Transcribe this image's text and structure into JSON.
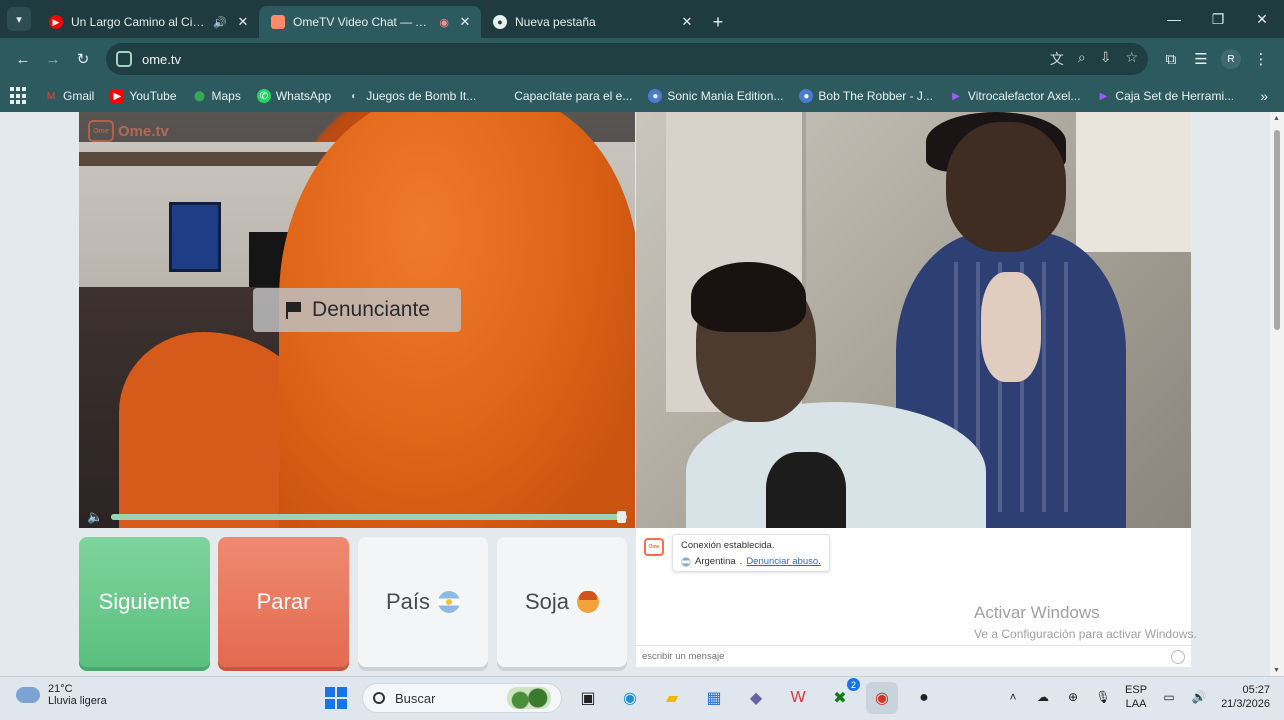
{
  "tabs": [
    {
      "title": "Un Largo Camino al Cielo |",
      "favicon": "youtube-icon",
      "favicon_color": "#ff0000",
      "extra": "audio-icon"
    },
    {
      "title": "OmeTV Video Chat — Alter",
      "favicon": "ometv-icon",
      "favicon_color": "#ff6b4a",
      "extra": "recording-icon"
    },
    {
      "title": "Nueva pestaña",
      "favicon": "chrome-icon",
      "favicon_color": "#e6eeee",
      "extra": ""
    }
  ],
  "toolbar": {
    "url": "ome.tv",
    "profile_initial": "R"
  },
  "bookmarks": [
    {
      "label": "Gmail",
      "icon": "gmail-icon",
      "color": "#ea4335"
    },
    {
      "label": "YouTube",
      "icon": "youtube-icon",
      "color": "#ff0000"
    },
    {
      "label": "Maps",
      "icon": "maps-icon",
      "color": "#34a853"
    },
    {
      "label": "WhatsApp",
      "icon": "whatsapp-icon",
      "color": "#25d366"
    },
    {
      "label": "Juegos de Bomb It...",
      "icon": "bomb-icon",
      "color": "#cccccc"
    },
    {
      "label": "Capacítate para el e...",
      "icon": "none",
      "color": ""
    },
    {
      "label": "Sonic Mania Edition...",
      "icon": "gamepad-icon",
      "color": "#4a7bd1"
    },
    {
      "label": "Bob The Robber - J...",
      "icon": "gamepad-icon",
      "color": "#4a7bd1"
    },
    {
      "label": "Vitrocalefactor Axel...",
      "icon": "arrow-icon",
      "color": "#7b3fe4"
    },
    {
      "label": "Caja Set de Herrami...",
      "icon": "arrow-icon",
      "color": "#7b3fe4"
    }
  ],
  "video": {
    "logo_text": "Ome.tv",
    "report_label": "Denunciante",
    "volume_level": 0.99
  },
  "controls": {
    "next_label": "Siguiente",
    "stop_label": "Parar",
    "country_label": "País",
    "gender_label": "Soja"
  },
  "chat": {
    "status": "Conexión establecida.",
    "country": "Argentina",
    "report_abuse": "Denunciar abuso.",
    "input_placeholder": "escribir un mensaje"
  },
  "watermark": {
    "line1": "Activar Windows",
    "line2": "Ve a Configuración para activar Windows."
  },
  "taskbar": {
    "temperature": "21°C",
    "weather": "Lluvia ligera",
    "search_label": "Buscar",
    "xbox_badge": "2",
    "lang_1": "ESP",
    "lang_2": "LAA",
    "time": "05:27",
    "date": "21/3/2026"
  }
}
